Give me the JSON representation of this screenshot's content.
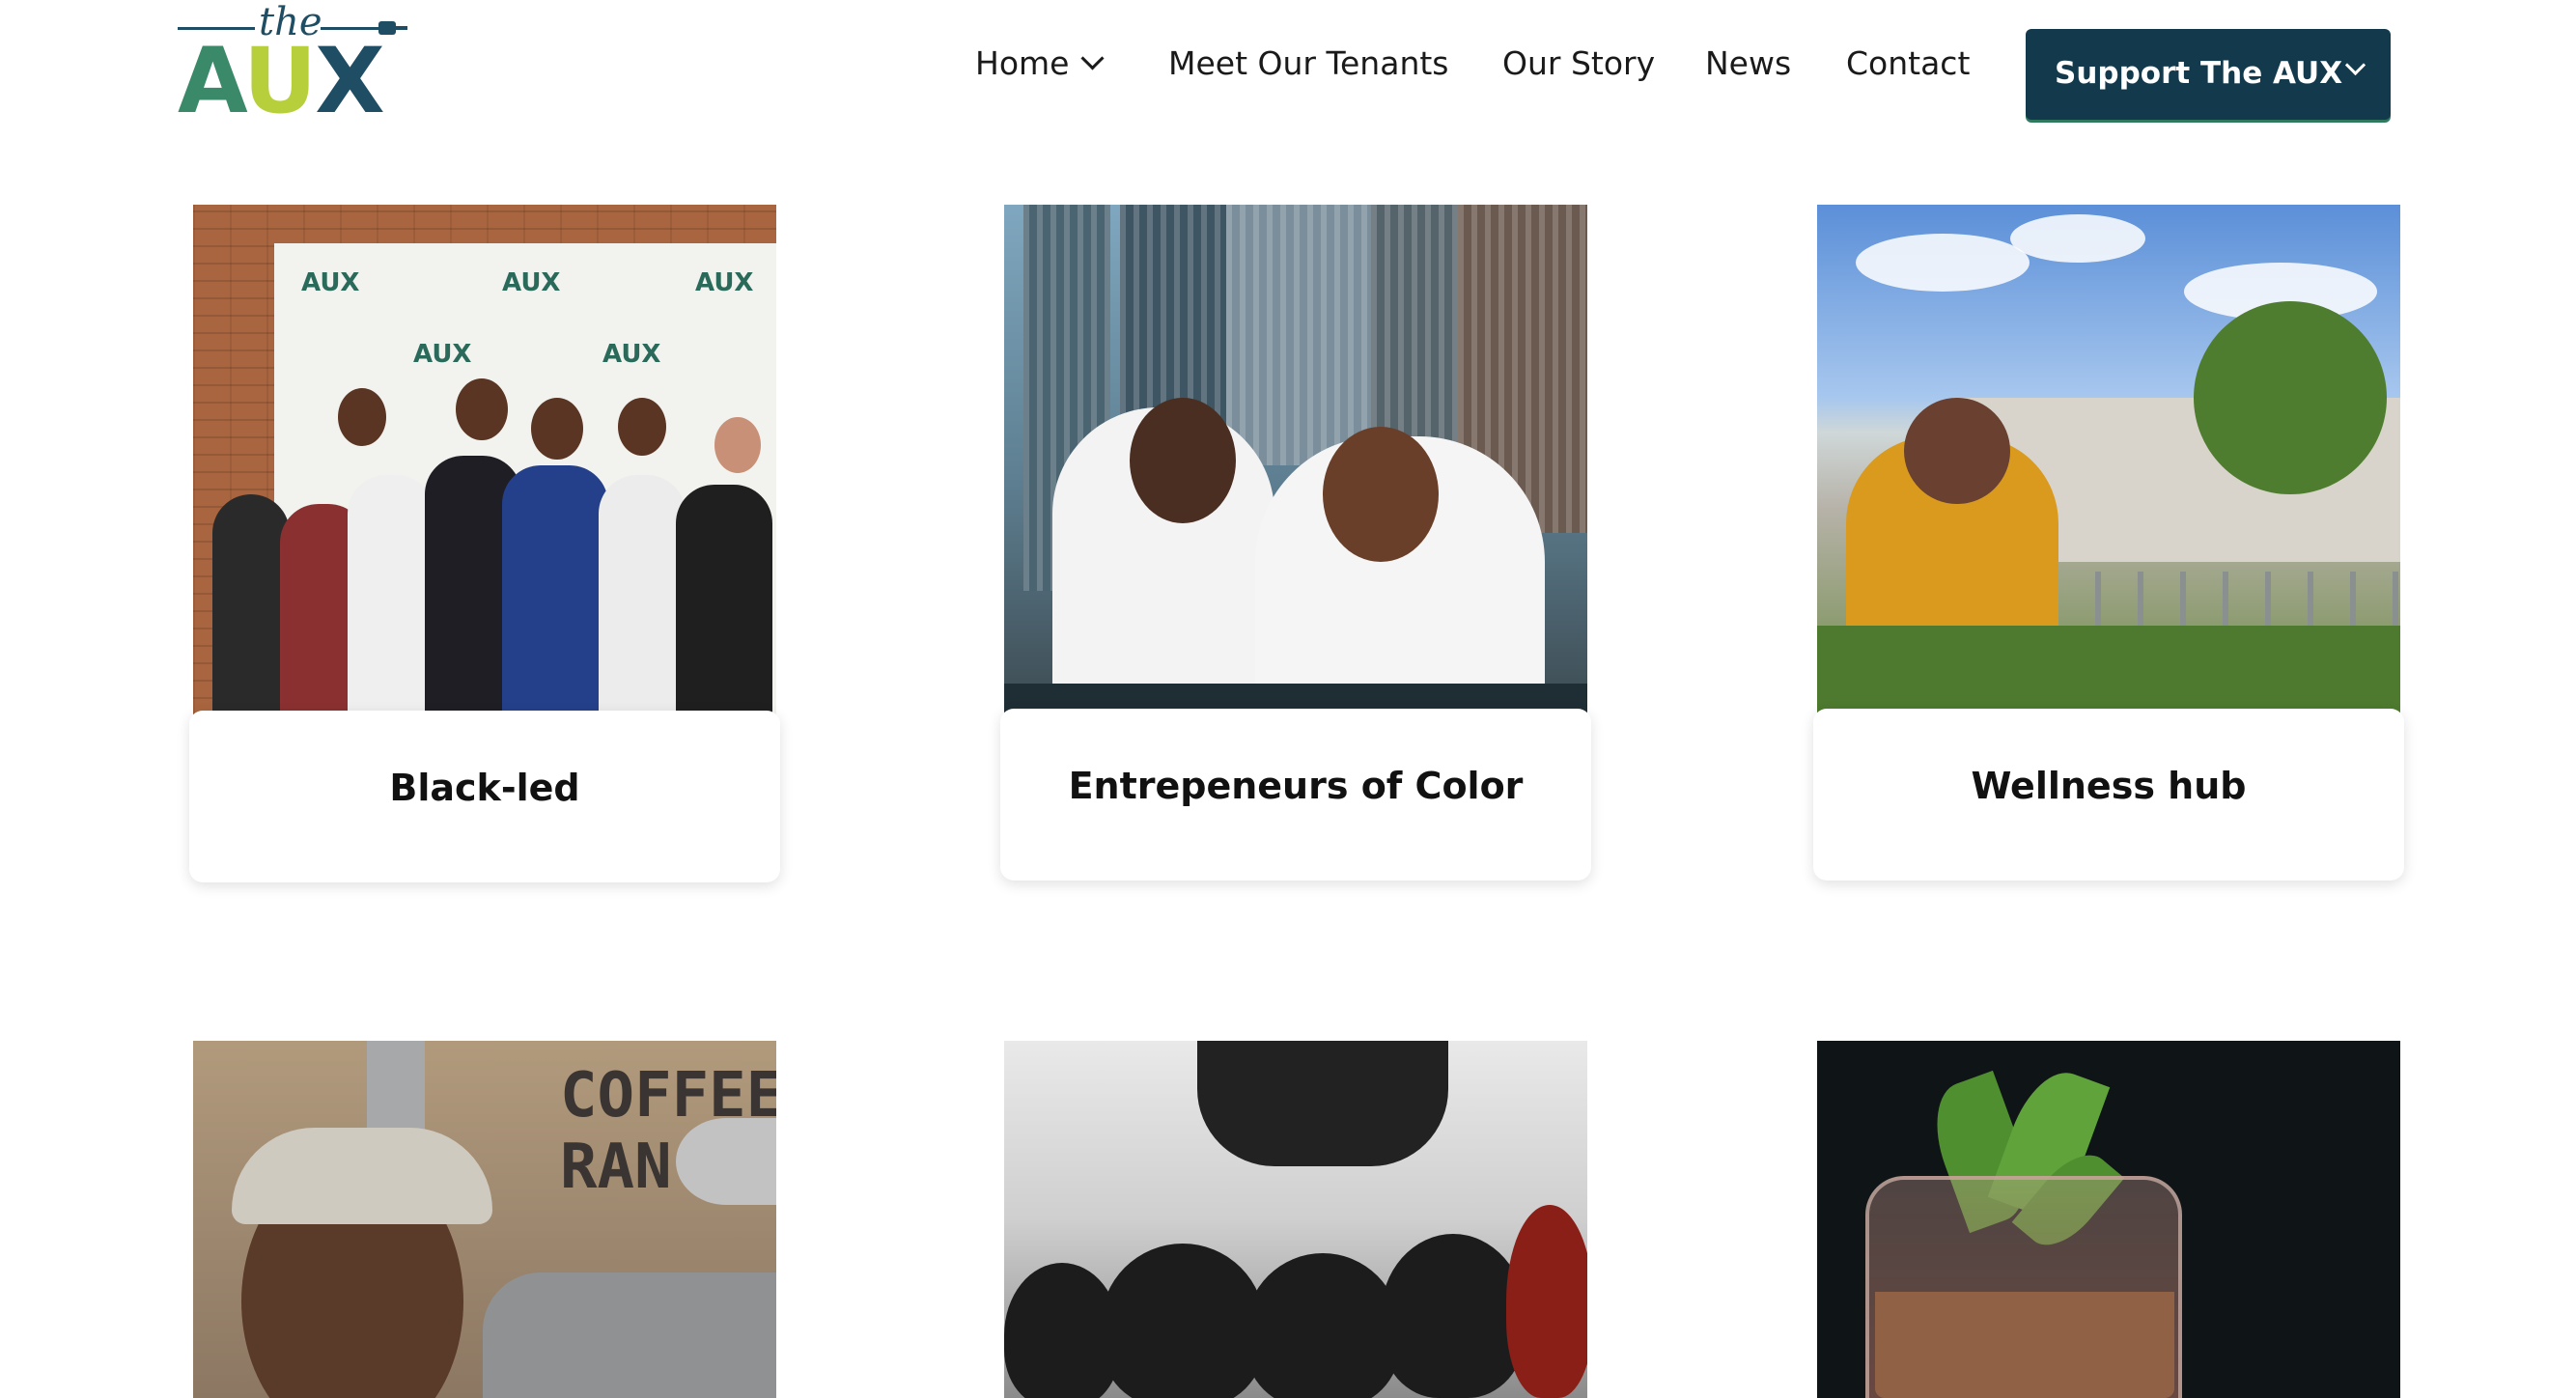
{
  "logo": {
    "the": "the",
    "aux_a": "A",
    "aux_u": "U",
    "aux_x": "X"
  },
  "nav": {
    "items": [
      {
        "label": "Home",
        "has_dropdown": true
      },
      {
        "label": "Meet Our Tenants"
      },
      {
        "label": "Our Story"
      },
      {
        "label": "News"
      },
      {
        "label": "Contact"
      }
    ],
    "cta": {
      "label": "Support The AUX",
      "has_dropdown": true
    }
  },
  "cards": [
    {
      "caption": "Black-led"
    },
    {
      "caption": "Entrepeneurs of Color"
    },
    {
      "caption": "Wellness hub"
    },
    {
      "caption": ""
    },
    {
      "caption": ""
    },
    {
      "caption": ""
    }
  ],
  "image_text": {
    "banner_tag_1": "AUX",
    "banner_tag_2": "AUX",
    "banner_tag_3": "AUX",
    "banner_tag_4": "AUX",
    "banner_tag_5": "AUX",
    "coffee_sign_1": "COFFEE",
    "coffee_sign_2": "RAN"
  },
  "colors": {
    "brand_dark": "#12394c",
    "brand_green": "#3a8a6a",
    "brand_lime": "#b7cf3b"
  }
}
